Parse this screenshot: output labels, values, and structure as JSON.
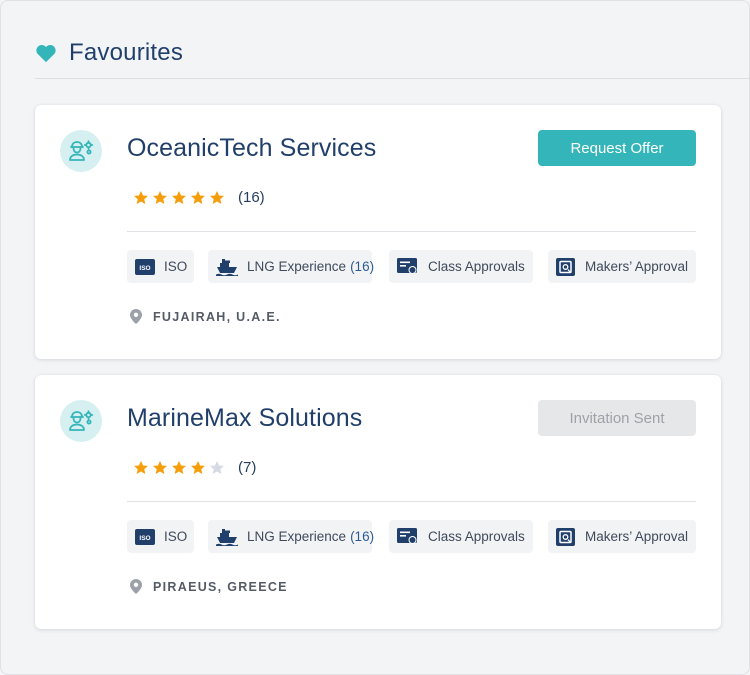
{
  "header": {
    "title": "Favourites"
  },
  "colors": {
    "accent": "#34b5b9",
    "title": "#213f6b",
    "star_on": "#f59e0b",
    "star_off": "#d6dbe3"
  },
  "cards": [
    {
      "name": "OceanicTech Services",
      "action_label": "Request Offer",
      "action_state": "primary",
      "rating": 5,
      "rating_max": 5,
      "rating_count": "(16)",
      "badges": [
        {
          "icon": "iso-icon",
          "label": "ISO"
        },
        {
          "icon": "lng-ship-icon",
          "label": "LNG Experience",
          "count": "(16)"
        },
        {
          "icon": "certificate-icon",
          "label": "Class Approvals"
        },
        {
          "icon": "approval-stamp-icon",
          "label": "Makers’ Approval"
        }
      ],
      "location": "FUJAIRAH, U.A.E."
    },
    {
      "name": "MarineMax Solutions",
      "action_label": "Invitation Sent",
      "action_state": "disabled",
      "rating": 4,
      "rating_max": 5,
      "rating_count": "(7)",
      "badges": [
        {
          "icon": "iso-icon",
          "label": "ISO"
        },
        {
          "icon": "lng-ship-icon",
          "label": "LNG Experience",
          "count": "(16)"
        },
        {
          "icon": "certificate-icon",
          "label": "Class Approvals"
        },
        {
          "icon": "approval-stamp-icon",
          "label": "Makers’ Approval"
        }
      ],
      "location": "PIRAEUS, GREECE"
    }
  ]
}
